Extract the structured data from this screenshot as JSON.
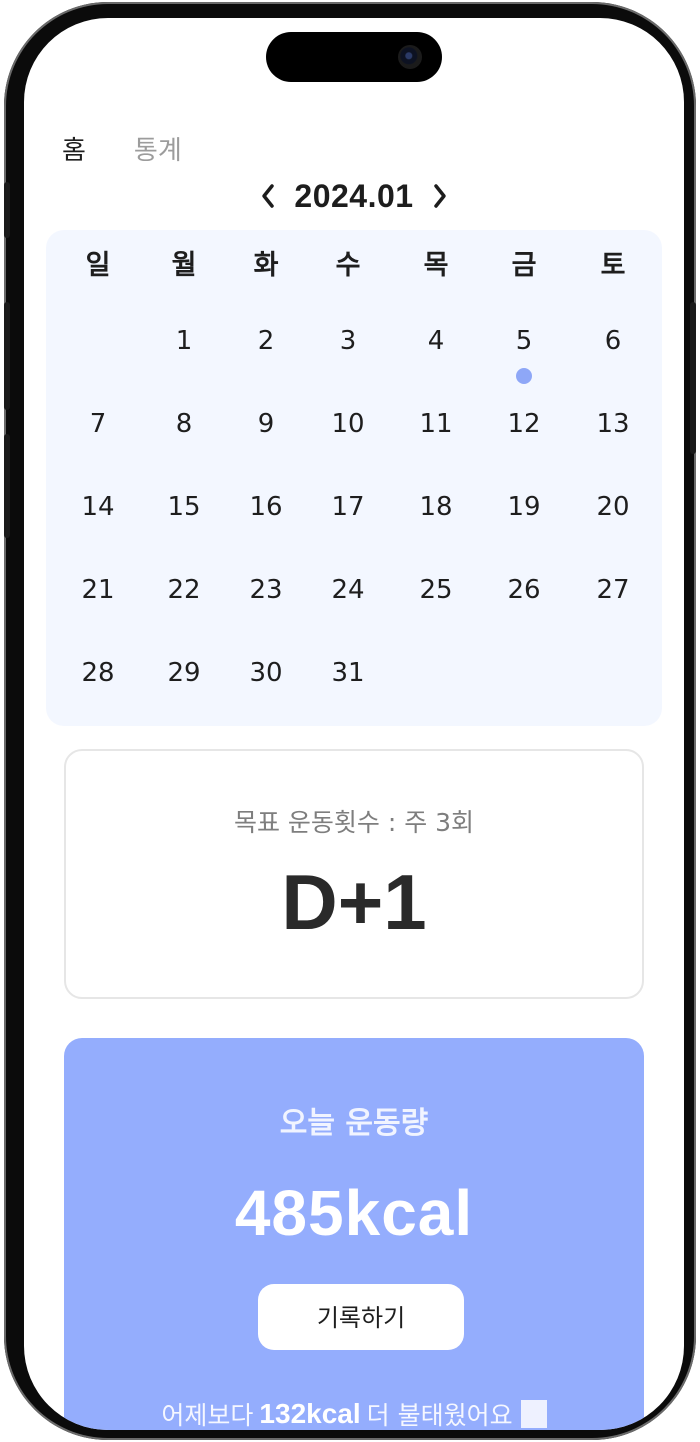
{
  "tabs": [
    {
      "label": "홈",
      "active": true
    },
    {
      "label": "통계",
      "active": false
    }
  ],
  "month_nav": {
    "prev_icon": "chevron-left-icon",
    "label": "2024.01",
    "next_icon": "chevron-right-icon"
  },
  "calendar": {
    "weekdays": [
      "일",
      "월",
      "화",
      "수",
      "목",
      "금",
      "토"
    ],
    "first_weekday_index": 1,
    "days_in_month": 31,
    "days": [
      "1",
      "2",
      "3",
      "4",
      "5",
      "6",
      "7",
      "8",
      "9",
      "10",
      "11",
      "12",
      "13",
      "14",
      "15",
      "16",
      "17",
      "18",
      "19",
      "20",
      "21",
      "22",
      "23",
      "24",
      "25",
      "26",
      "27",
      "28",
      "29",
      "30",
      "31"
    ],
    "event_days": [
      5
    ],
    "event_dot_color": "#8ea7f7",
    "background_color": "#f3f7ff"
  },
  "goal": {
    "text": "목표 운동횟수 : 주 3회",
    "dday": "D+1"
  },
  "today": {
    "title": "오늘 운동량",
    "kcal": "485kcal",
    "record_button": "기록하기",
    "compare_prefix": "어제보다",
    "compare_value": "132kcal",
    "compare_suffix": "더 불태웠어요",
    "card_color": "#94adfd"
  }
}
